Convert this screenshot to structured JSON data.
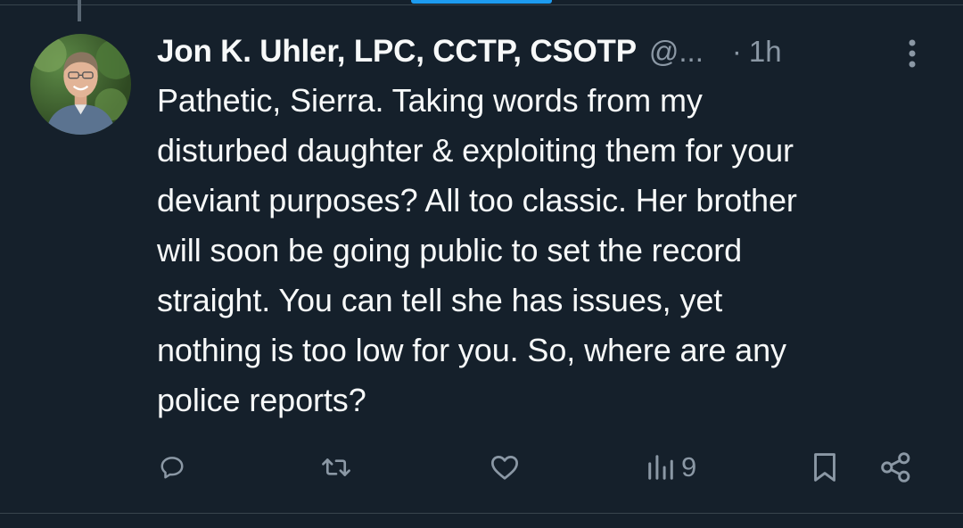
{
  "tweet": {
    "display_name": "Jon K. Uhler, LPC, CCTP, CSOTP",
    "handle": "@...",
    "separator": "·",
    "time": "1h",
    "text": "Pathetic, Sierra. Taking words from my\ndisturbed daughter & exploiting them for your\ndeviant purposes? All too classic. Her brother\nwill soon be going public to set the record\nstraight. You can tell she has issues, yet\nnothing is too low for you. So, where are any\npolice reports?",
    "views": "9"
  },
  "icons": {
    "more": "more-vertical-icon",
    "reply": "reply-icon",
    "retweet": "retweet-icon",
    "like": "heart-icon",
    "views": "analytics-icon",
    "bookmark": "bookmark-icon",
    "share": "share-icon"
  },
  "colors": {
    "background": "#15202b",
    "text": "#f7f9f9",
    "secondary": "#8b98a5",
    "accent": "#1d9bf0",
    "divider": "#38444d"
  }
}
